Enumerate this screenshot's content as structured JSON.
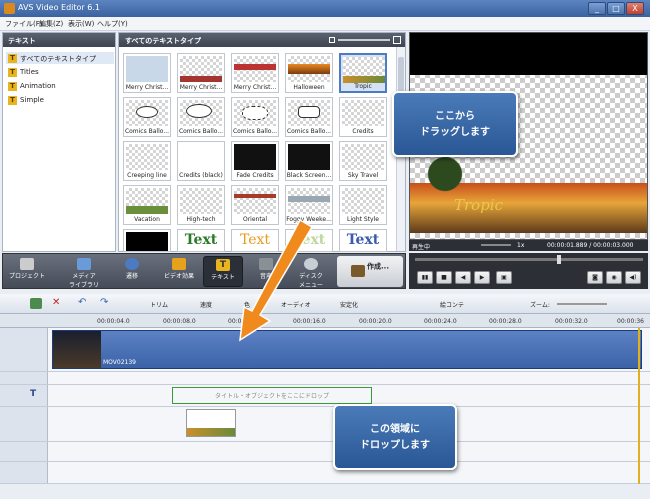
{
  "window": {
    "title": "AVS Video Editor 6.1",
    "controls": [
      "_",
      "□",
      "X"
    ]
  },
  "menu": [
    "ファイル(F)",
    "編集(Z)",
    "表示(W)",
    "ヘルプ(Y)"
  ],
  "left_panel": {
    "header": "テキスト",
    "items": [
      "すべてのテキストタイプ",
      "Titles",
      "Animation",
      "Simple"
    ]
  },
  "middle_panel": {
    "header": "すべてのテキストタイプ",
    "thumbs": [
      "Merry Christ...",
      "Merry Christ...",
      "Merry Christ...",
      "Halloween",
      "Tropic",
      "Comics Ballo...",
      "Comics Ballo...",
      "Comics Ballo...",
      "Comics Ballo...",
      "Credits",
      "Creeping line",
      "Credits (black)",
      "Fade Credits",
      "Black Screen...",
      "Sky Travel",
      "Vacation",
      "High-tech",
      "Oriental",
      "Foggy Weeke...",
      "Light Style",
      "",
      "Text",
      "Text",
      "Text",
      "Text"
    ]
  },
  "preview": {
    "overlay_title": "Tropic",
    "status_left": "再生中",
    "speed": "1x",
    "time": "00:00:01.889 / 00:00:03.000"
  },
  "toolbar": {
    "buttons": [
      "プロジェクト",
      "メディア\nライブラリ",
      "遷移",
      "ビデオ効果",
      "テキスト",
      "音声",
      "ディスク\nメニュー",
      "作成..."
    ]
  },
  "timeline_tools": [
    "トリム",
    "速度",
    "色",
    "オーディオ",
    "安定化",
    "絵コンテ",
    "ズーム:"
  ],
  "ruler": [
    "00:00:04.0",
    "00:00:08.0",
    "00:00:12.0",
    "00:00:16.0",
    "00:00:20.0",
    "00:00:24.0",
    "00:00:28.0",
    "00:00:32.0",
    "00:00:36"
  ],
  "video_clip": {
    "name": "MOV02139"
  },
  "drop_zone": {
    "text": "タイトル・オブジェクトをここにドロップ"
  },
  "callouts": {
    "top": "ここから\nドラッグします",
    "bottom": "この領域に\nドロップします"
  }
}
